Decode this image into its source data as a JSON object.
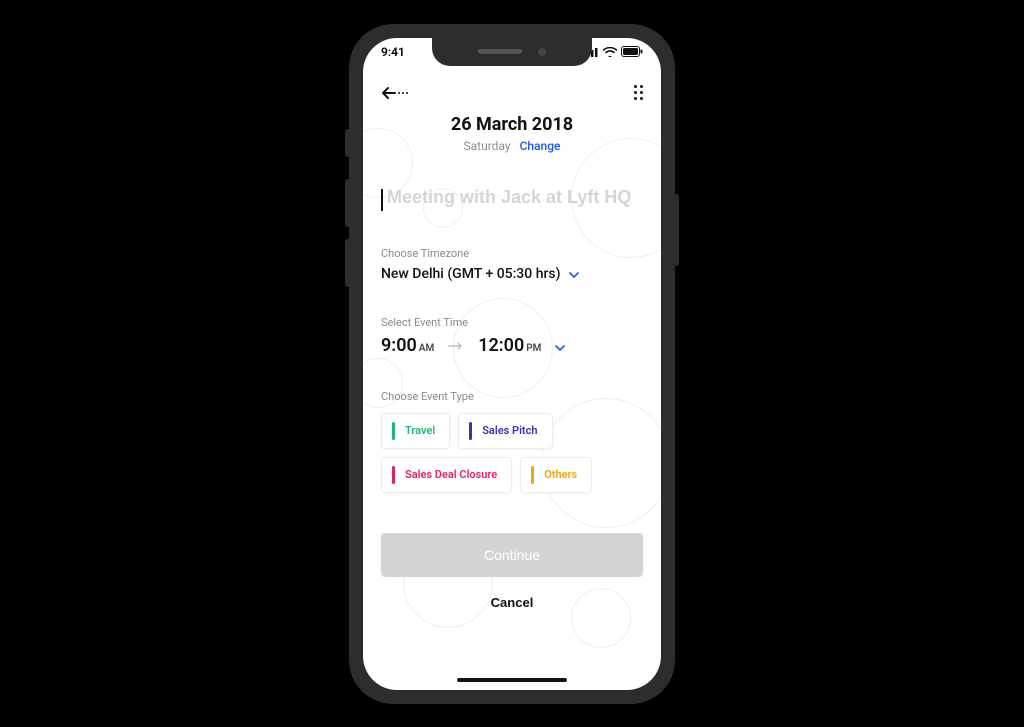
{
  "status": {
    "time": "9:41"
  },
  "header": {
    "date_title": "26 March 2018",
    "day": "Saturday",
    "change_label": "Change"
  },
  "title_input": {
    "placeholder": "Meeting with Jack at Lyft HQ",
    "value": ""
  },
  "timezone": {
    "label": "Choose Timezone",
    "value": "New Delhi (GMT + 05:30 hrs)"
  },
  "event_time": {
    "label": "Select Event Time",
    "start_time": "9:00",
    "start_ampm": "AM",
    "end_time": "12:00",
    "end_ampm": "PM"
  },
  "event_type": {
    "label": "Choose Event Type",
    "options": [
      {
        "label": "Travel",
        "color": "#1fb872"
      },
      {
        "label": "Sales Pitch",
        "color": "#3c2fb5"
      },
      {
        "label": "Sales Deal Closure",
        "color": "#e61d6e"
      },
      {
        "label": "Others",
        "color": "#f4a316"
      }
    ]
  },
  "actions": {
    "continue": "Continue",
    "cancel": "Cancel"
  }
}
